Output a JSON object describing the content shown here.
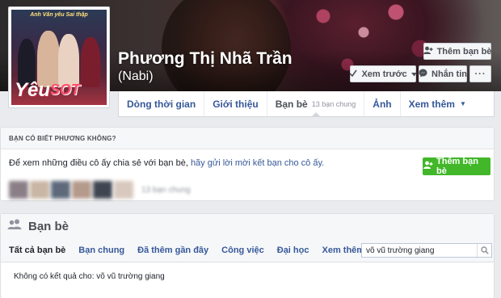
{
  "profile": {
    "name": "Phương Thị Nhã Trần",
    "alternate_name": "(Nabi)",
    "poster": {
      "tagline": "Anh Văn yêu Sai thập",
      "title_main": "Yêu",
      "title_sub": "SOT"
    }
  },
  "actions": {
    "add_friend_label": "Thêm bạn bè",
    "follow_label": "Xem trước",
    "message_label": "Nhắn tin",
    "more_label": "···"
  },
  "tabs": [
    {
      "label": "Dòng thời gian"
    },
    {
      "label": "Giới thiệu"
    },
    {
      "label": "Bạn bè",
      "sub": "13 bạn chung"
    },
    {
      "label": "Ảnh"
    },
    {
      "label": "Xem thêm"
    }
  ],
  "know_box": {
    "header": "BẠN CÓ BIẾT PHƯƠNG KHÔNG?",
    "text_before": "Để xem những điều cô ấy chia sẻ với bạn bè, ",
    "link": "hãy gửi lời mời kết bạn cho cô ấy.",
    "button_label": "Thêm bạn bè",
    "mutual_count": "13 bạn chung"
  },
  "friends": {
    "title": "Bạn bè",
    "subtabs": [
      {
        "label": "Tất cả bạn bè"
      },
      {
        "label": "Bạn chung"
      },
      {
        "label": "Đã thêm gần đây"
      },
      {
        "label": "Công việc"
      },
      {
        "label": "Đại học"
      },
      {
        "label": "Xem thêm"
      }
    ],
    "search_value": "võ vũ trường giang",
    "no_result": "Không có kết quả cho: võ vũ trường giang"
  },
  "colors": {
    "link_blue": "#365899",
    "green_button": "#42b72a",
    "page_bg": "#e9ebee"
  }
}
